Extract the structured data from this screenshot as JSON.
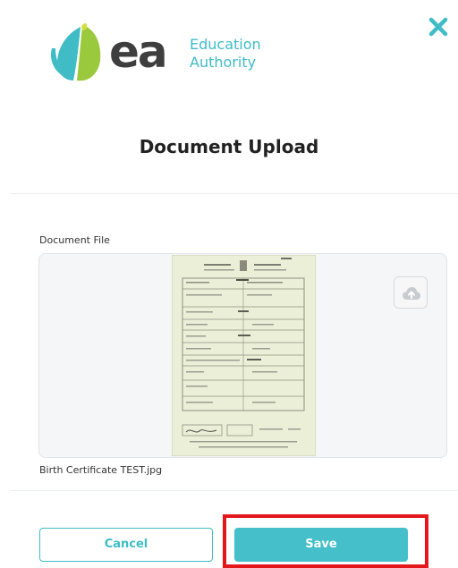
{
  "header": {
    "logo": {
      "mark": "ea",
      "text_line1": "Education",
      "text_line2": "Authority",
      "colors": {
        "teal": "#3fbcc6",
        "green": "#9bc93e",
        "dark": "#3e3e3e"
      }
    },
    "close_icon": "close-icon"
  },
  "dialog": {
    "title": "Document Upload",
    "field_label": "Document File",
    "file_name": "Birth Certificate TEST.jpg",
    "upload_icon": "cloud-upload-icon"
  },
  "actions": {
    "cancel_label": "Cancel",
    "save_label": "Save"
  },
  "colors": {
    "accent": "#3fbcc6",
    "highlight": "#e3181d"
  }
}
